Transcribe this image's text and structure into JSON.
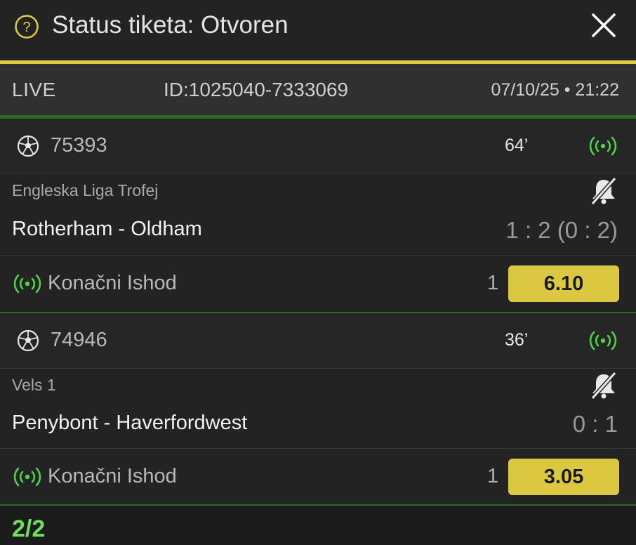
{
  "header": {
    "title": "Status tiketa: Otvoren",
    "help_icon": "question-circle-icon",
    "close_icon": "close-icon"
  },
  "info": {
    "mode": "LIVE",
    "ticket_id": "ID:1025040-7333069",
    "datetime": "07/10/25 • 21:22"
  },
  "events": [
    {
      "code": "75393",
      "minute": "64’",
      "league": "Engleska Liga Trofej",
      "match": "Rotherham - Oldham",
      "score": "1 : 2 (0 : 2)",
      "market": "Konačni Ishod",
      "pick": "1",
      "odds": "6.10"
    },
    {
      "code": "74946",
      "minute": "36’",
      "league": "Vels 1",
      "match": "Penybont - Haverfordwest",
      "score": "0 : 1",
      "market": "Konačni Ishod",
      "pick": "1",
      "odds": "3.05"
    }
  ],
  "footer": {
    "count": "2/2"
  },
  "colors": {
    "accent_yellow": "#dcc840",
    "live_green": "#4fd24a",
    "background": "#232323"
  }
}
